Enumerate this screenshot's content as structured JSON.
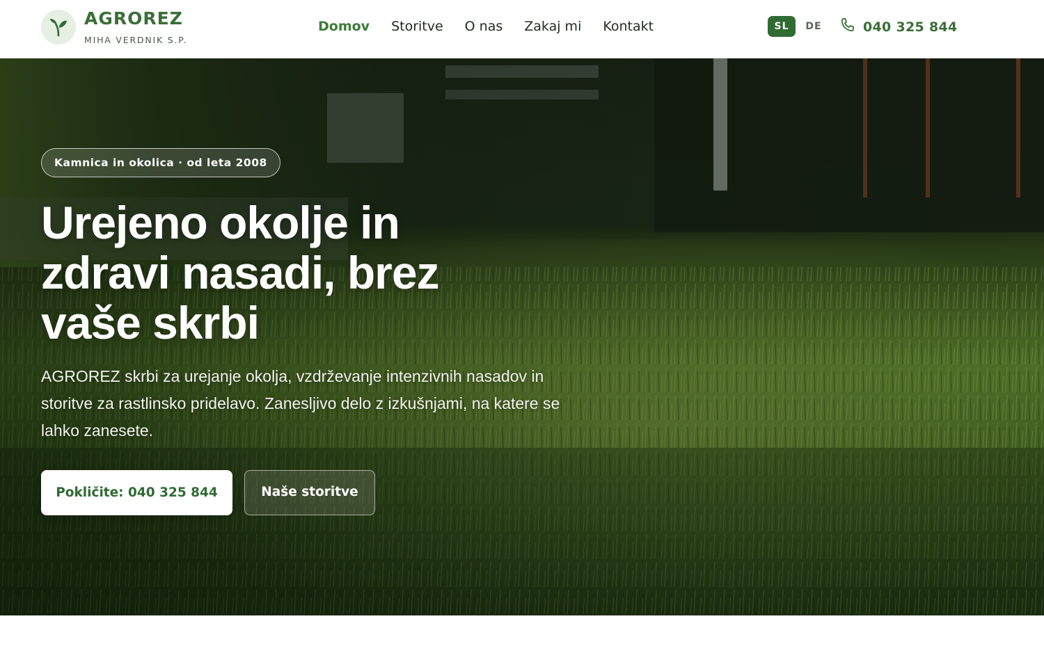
{
  "header": {
    "brand": "AGROREZ",
    "tagline": "MIHA VERDNIK S.P.",
    "logo_icon": "leaf-sprout-icon",
    "nav": [
      {
        "label": "Domov",
        "active": true
      },
      {
        "label": "Storitve",
        "active": false
      },
      {
        "label": "O nas",
        "active": false
      },
      {
        "label": "Zakaj mi",
        "active": false
      },
      {
        "label": "Kontakt",
        "active": false
      }
    ],
    "languages": [
      {
        "label": "SL",
        "selected": true
      },
      {
        "label": "DE",
        "selected": false
      }
    ],
    "phone_icon": "phone-icon",
    "phone": "040 325 844"
  },
  "hero": {
    "badge": "Kamnica in okolica · od leta 2008",
    "headline": "Urejeno okolje in zdravi nasadi, brez vaše skrbi",
    "lead": "AGROREZ skrbi za urejanje okolja, vzdrževanje intenzivnih nasadov in storitve za rastlinsko pridelavo. Zanesljivo delo z izkušnjami, na katere se lahko zanesete.",
    "cta_primary": "Pokličite: 040 325 844",
    "cta_secondary": "Naše storitve",
    "background": "lawn-grass-photo"
  },
  "colors": {
    "brand_green": "#3b6e38",
    "nav_active": "#3b7d3a",
    "lang_selected_bg": "#2f6b33",
    "lawn_dark": "#1f3a14",
    "lawn_light": "#6f9a3a"
  }
}
